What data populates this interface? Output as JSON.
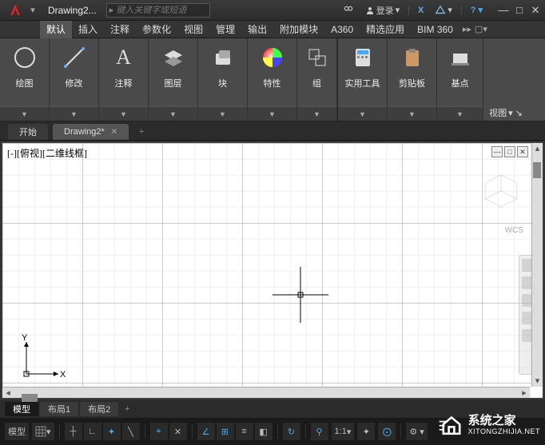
{
  "title": {
    "doc": "Drawing2...",
    "search_placeholder": "键入关键字或短语",
    "login": "登录"
  },
  "menubar": [
    "默认",
    "插入",
    "注释",
    "参数化",
    "视图",
    "管理",
    "输出",
    "附加模块",
    "A360",
    "精选应用",
    "BIM 360"
  ],
  "ribbon": {
    "panels": [
      {
        "label": "绘图",
        "icon": "circle"
      },
      {
        "label": "修改",
        "icon": "move"
      },
      {
        "label": "注释",
        "icon": "text"
      },
      {
        "label": "图层",
        "icon": "layers"
      },
      {
        "label": "块",
        "icon": "block"
      },
      {
        "label": "特性",
        "icon": "wheel"
      },
      {
        "label": "组",
        "icon": "group",
        "sep": true
      },
      {
        "label": "实用工具",
        "icon": "calc"
      },
      {
        "label": "剪贴板",
        "icon": "clip"
      },
      {
        "label": "基点",
        "icon": "base"
      }
    ],
    "side_label": "视图"
  },
  "doc_tabs": {
    "start": "开始",
    "active": "Drawing2*"
  },
  "viewport": {
    "label": "[-][俯视][二维线框]",
    "wcs": "WCS",
    "axes": {
      "x": "X",
      "y": "Y"
    }
  },
  "layout_tabs": [
    "模型",
    "布局1",
    "布局2"
  ],
  "status": {
    "model": "模型",
    "scale": "1:1"
  },
  "watermark": {
    "main": "系统之家",
    "sub": "XITONGZHIJIA.NET"
  }
}
